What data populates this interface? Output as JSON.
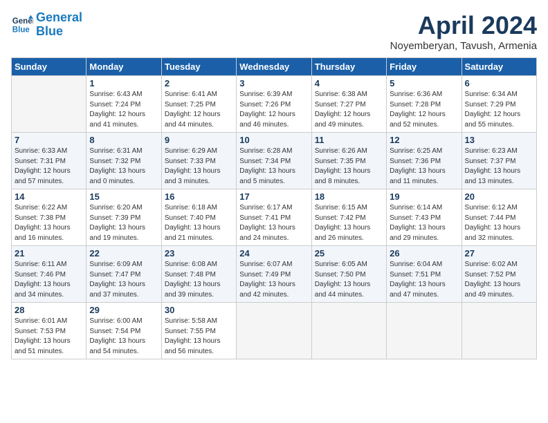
{
  "header": {
    "logo_line1": "General",
    "logo_line2": "Blue",
    "month": "April 2024",
    "location": "Noyemberyan, Tavush, Armenia"
  },
  "weekdays": [
    "Sunday",
    "Monday",
    "Tuesday",
    "Wednesday",
    "Thursday",
    "Friday",
    "Saturday"
  ],
  "weeks": [
    [
      {
        "day": "",
        "info": ""
      },
      {
        "day": "1",
        "info": "Sunrise: 6:43 AM\nSunset: 7:24 PM\nDaylight: 12 hours\nand 41 minutes."
      },
      {
        "day": "2",
        "info": "Sunrise: 6:41 AM\nSunset: 7:25 PM\nDaylight: 12 hours\nand 44 minutes."
      },
      {
        "day": "3",
        "info": "Sunrise: 6:39 AM\nSunset: 7:26 PM\nDaylight: 12 hours\nand 46 minutes."
      },
      {
        "day": "4",
        "info": "Sunrise: 6:38 AM\nSunset: 7:27 PM\nDaylight: 12 hours\nand 49 minutes."
      },
      {
        "day": "5",
        "info": "Sunrise: 6:36 AM\nSunset: 7:28 PM\nDaylight: 12 hours\nand 52 minutes."
      },
      {
        "day": "6",
        "info": "Sunrise: 6:34 AM\nSunset: 7:29 PM\nDaylight: 12 hours\nand 55 minutes."
      }
    ],
    [
      {
        "day": "7",
        "info": "Sunrise: 6:33 AM\nSunset: 7:31 PM\nDaylight: 12 hours\nand 57 minutes."
      },
      {
        "day": "8",
        "info": "Sunrise: 6:31 AM\nSunset: 7:32 PM\nDaylight: 13 hours\nand 0 minutes."
      },
      {
        "day": "9",
        "info": "Sunrise: 6:29 AM\nSunset: 7:33 PM\nDaylight: 13 hours\nand 3 minutes."
      },
      {
        "day": "10",
        "info": "Sunrise: 6:28 AM\nSunset: 7:34 PM\nDaylight: 13 hours\nand 5 minutes."
      },
      {
        "day": "11",
        "info": "Sunrise: 6:26 AM\nSunset: 7:35 PM\nDaylight: 13 hours\nand 8 minutes."
      },
      {
        "day": "12",
        "info": "Sunrise: 6:25 AM\nSunset: 7:36 PM\nDaylight: 13 hours\nand 11 minutes."
      },
      {
        "day": "13",
        "info": "Sunrise: 6:23 AM\nSunset: 7:37 PM\nDaylight: 13 hours\nand 13 minutes."
      }
    ],
    [
      {
        "day": "14",
        "info": "Sunrise: 6:22 AM\nSunset: 7:38 PM\nDaylight: 13 hours\nand 16 minutes."
      },
      {
        "day": "15",
        "info": "Sunrise: 6:20 AM\nSunset: 7:39 PM\nDaylight: 13 hours\nand 19 minutes."
      },
      {
        "day": "16",
        "info": "Sunrise: 6:18 AM\nSunset: 7:40 PM\nDaylight: 13 hours\nand 21 minutes."
      },
      {
        "day": "17",
        "info": "Sunrise: 6:17 AM\nSunset: 7:41 PM\nDaylight: 13 hours\nand 24 minutes."
      },
      {
        "day": "18",
        "info": "Sunrise: 6:15 AM\nSunset: 7:42 PM\nDaylight: 13 hours\nand 26 minutes."
      },
      {
        "day": "19",
        "info": "Sunrise: 6:14 AM\nSunset: 7:43 PM\nDaylight: 13 hours\nand 29 minutes."
      },
      {
        "day": "20",
        "info": "Sunrise: 6:12 AM\nSunset: 7:44 PM\nDaylight: 13 hours\nand 32 minutes."
      }
    ],
    [
      {
        "day": "21",
        "info": "Sunrise: 6:11 AM\nSunset: 7:46 PM\nDaylight: 13 hours\nand 34 minutes."
      },
      {
        "day": "22",
        "info": "Sunrise: 6:09 AM\nSunset: 7:47 PM\nDaylight: 13 hours\nand 37 minutes."
      },
      {
        "day": "23",
        "info": "Sunrise: 6:08 AM\nSunset: 7:48 PM\nDaylight: 13 hours\nand 39 minutes."
      },
      {
        "day": "24",
        "info": "Sunrise: 6:07 AM\nSunset: 7:49 PM\nDaylight: 13 hours\nand 42 minutes."
      },
      {
        "day": "25",
        "info": "Sunrise: 6:05 AM\nSunset: 7:50 PM\nDaylight: 13 hours\nand 44 minutes."
      },
      {
        "day": "26",
        "info": "Sunrise: 6:04 AM\nSunset: 7:51 PM\nDaylight: 13 hours\nand 47 minutes."
      },
      {
        "day": "27",
        "info": "Sunrise: 6:02 AM\nSunset: 7:52 PM\nDaylight: 13 hours\nand 49 minutes."
      }
    ],
    [
      {
        "day": "28",
        "info": "Sunrise: 6:01 AM\nSunset: 7:53 PM\nDaylight: 13 hours\nand 51 minutes."
      },
      {
        "day": "29",
        "info": "Sunrise: 6:00 AM\nSunset: 7:54 PM\nDaylight: 13 hours\nand 54 minutes."
      },
      {
        "day": "30",
        "info": "Sunrise: 5:58 AM\nSunset: 7:55 PM\nDaylight: 13 hours\nand 56 minutes."
      },
      {
        "day": "",
        "info": ""
      },
      {
        "day": "",
        "info": ""
      },
      {
        "day": "",
        "info": ""
      },
      {
        "day": "",
        "info": ""
      }
    ]
  ]
}
